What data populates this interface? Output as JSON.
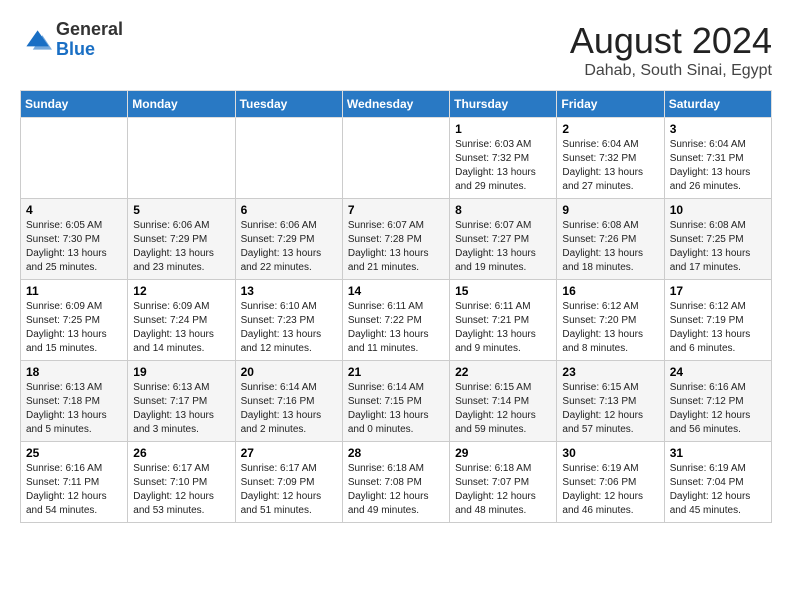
{
  "header": {
    "logo_general": "General",
    "logo_blue": "Blue",
    "month_year": "August 2024",
    "location": "Dahab, South Sinai, Egypt"
  },
  "weekdays": [
    "Sunday",
    "Monday",
    "Tuesday",
    "Wednesday",
    "Thursday",
    "Friday",
    "Saturday"
  ],
  "weeks": [
    [
      {
        "day": "",
        "content": ""
      },
      {
        "day": "",
        "content": ""
      },
      {
        "day": "",
        "content": ""
      },
      {
        "day": "",
        "content": ""
      },
      {
        "day": "1",
        "content": "Sunrise: 6:03 AM\nSunset: 7:32 PM\nDaylight: 13 hours\nand 29 minutes."
      },
      {
        "day": "2",
        "content": "Sunrise: 6:04 AM\nSunset: 7:32 PM\nDaylight: 13 hours\nand 27 minutes."
      },
      {
        "day": "3",
        "content": "Sunrise: 6:04 AM\nSunset: 7:31 PM\nDaylight: 13 hours\nand 26 minutes."
      }
    ],
    [
      {
        "day": "4",
        "content": "Sunrise: 6:05 AM\nSunset: 7:30 PM\nDaylight: 13 hours\nand 25 minutes."
      },
      {
        "day": "5",
        "content": "Sunrise: 6:06 AM\nSunset: 7:29 PM\nDaylight: 13 hours\nand 23 minutes."
      },
      {
        "day": "6",
        "content": "Sunrise: 6:06 AM\nSunset: 7:29 PM\nDaylight: 13 hours\nand 22 minutes."
      },
      {
        "day": "7",
        "content": "Sunrise: 6:07 AM\nSunset: 7:28 PM\nDaylight: 13 hours\nand 21 minutes."
      },
      {
        "day": "8",
        "content": "Sunrise: 6:07 AM\nSunset: 7:27 PM\nDaylight: 13 hours\nand 19 minutes."
      },
      {
        "day": "9",
        "content": "Sunrise: 6:08 AM\nSunset: 7:26 PM\nDaylight: 13 hours\nand 18 minutes."
      },
      {
        "day": "10",
        "content": "Sunrise: 6:08 AM\nSunset: 7:25 PM\nDaylight: 13 hours\nand 17 minutes."
      }
    ],
    [
      {
        "day": "11",
        "content": "Sunrise: 6:09 AM\nSunset: 7:25 PM\nDaylight: 13 hours\nand 15 minutes."
      },
      {
        "day": "12",
        "content": "Sunrise: 6:09 AM\nSunset: 7:24 PM\nDaylight: 13 hours\nand 14 minutes."
      },
      {
        "day": "13",
        "content": "Sunrise: 6:10 AM\nSunset: 7:23 PM\nDaylight: 13 hours\nand 12 minutes."
      },
      {
        "day": "14",
        "content": "Sunrise: 6:11 AM\nSunset: 7:22 PM\nDaylight: 13 hours\nand 11 minutes."
      },
      {
        "day": "15",
        "content": "Sunrise: 6:11 AM\nSunset: 7:21 PM\nDaylight: 13 hours\nand 9 minutes."
      },
      {
        "day": "16",
        "content": "Sunrise: 6:12 AM\nSunset: 7:20 PM\nDaylight: 13 hours\nand 8 minutes."
      },
      {
        "day": "17",
        "content": "Sunrise: 6:12 AM\nSunset: 7:19 PM\nDaylight: 13 hours\nand 6 minutes."
      }
    ],
    [
      {
        "day": "18",
        "content": "Sunrise: 6:13 AM\nSunset: 7:18 PM\nDaylight: 13 hours\nand 5 minutes."
      },
      {
        "day": "19",
        "content": "Sunrise: 6:13 AM\nSunset: 7:17 PM\nDaylight: 13 hours\nand 3 minutes."
      },
      {
        "day": "20",
        "content": "Sunrise: 6:14 AM\nSunset: 7:16 PM\nDaylight: 13 hours\nand 2 minutes."
      },
      {
        "day": "21",
        "content": "Sunrise: 6:14 AM\nSunset: 7:15 PM\nDaylight: 13 hours\nand 0 minutes."
      },
      {
        "day": "22",
        "content": "Sunrise: 6:15 AM\nSunset: 7:14 PM\nDaylight: 12 hours\nand 59 minutes."
      },
      {
        "day": "23",
        "content": "Sunrise: 6:15 AM\nSunset: 7:13 PM\nDaylight: 12 hours\nand 57 minutes."
      },
      {
        "day": "24",
        "content": "Sunrise: 6:16 AM\nSunset: 7:12 PM\nDaylight: 12 hours\nand 56 minutes."
      }
    ],
    [
      {
        "day": "25",
        "content": "Sunrise: 6:16 AM\nSunset: 7:11 PM\nDaylight: 12 hours\nand 54 minutes."
      },
      {
        "day": "26",
        "content": "Sunrise: 6:17 AM\nSunset: 7:10 PM\nDaylight: 12 hours\nand 53 minutes."
      },
      {
        "day": "27",
        "content": "Sunrise: 6:17 AM\nSunset: 7:09 PM\nDaylight: 12 hours\nand 51 minutes."
      },
      {
        "day": "28",
        "content": "Sunrise: 6:18 AM\nSunset: 7:08 PM\nDaylight: 12 hours\nand 49 minutes."
      },
      {
        "day": "29",
        "content": "Sunrise: 6:18 AM\nSunset: 7:07 PM\nDaylight: 12 hours\nand 48 minutes."
      },
      {
        "day": "30",
        "content": "Sunrise: 6:19 AM\nSunset: 7:06 PM\nDaylight: 12 hours\nand 46 minutes."
      },
      {
        "day": "31",
        "content": "Sunrise: 6:19 AM\nSunset: 7:04 PM\nDaylight: 12 hours\nand 45 minutes."
      }
    ]
  ]
}
